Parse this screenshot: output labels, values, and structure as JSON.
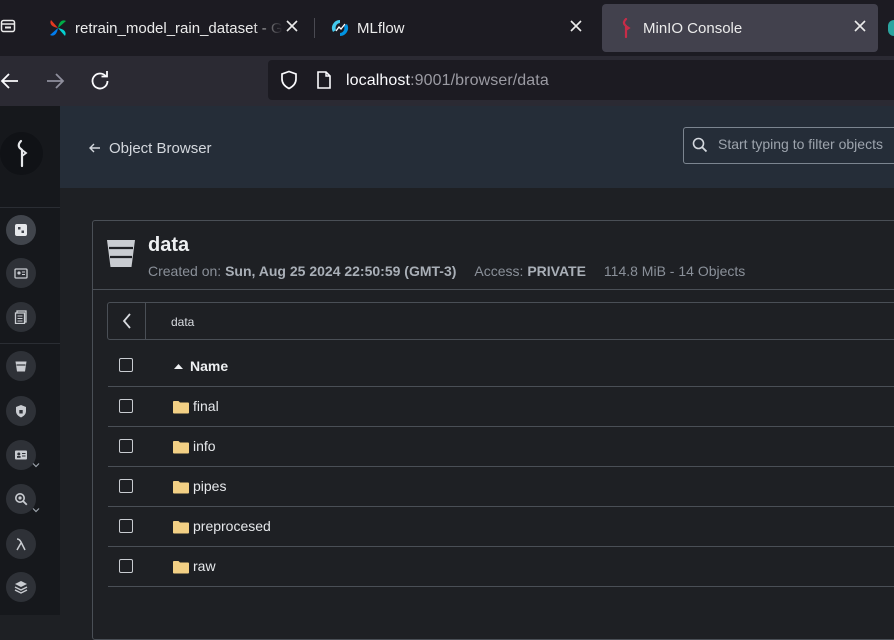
{
  "browser": {
    "tabs": [
      {
        "title": "retrain_model_rain_dataset - Gr",
        "favicon": "airflow-icon",
        "active": false
      },
      {
        "title": "MLflow",
        "favicon": "mlflow-icon",
        "active": false
      },
      {
        "title": "MinIO Console",
        "favicon": "minio-icon",
        "active": true
      }
    ],
    "url": {
      "host": "localhost",
      "rest": ":9001/browser/data"
    }
  },
  "sidebar": {
    "items": [
      "buckets-icon",
      "access-keys-icon",
      "documentation-icon",
      "bucket-icon",
      "policies-icon",
      "identity-icon",
      "monitoring-icon",
      "lambda-icon",
      "tiers-icon"
    ]
  },
  "header": {
    "back_label": "Object Browser",
    "filter_placeholder": "Start typing to filter objects"
  },
  "bucket": {
    "name": "data",
    "created_label": "Created on:",
    "created_value": "Sun, Aug 25 2024 22:50:59 (GMT-3)",
    "access_label": "Access:",
    "access_value": "PRIVATE",
    "size_summary": "114.8 MiB - 14 Objects"
  },
  "breadcrumb": {
    "path": "data"
  },
  "table": {
    "column_name": "Name",
    "rows": [
      {
        "name": "final",
        "type": "folder"
      },
      {
        "name": "info",
        "type": "folder"
      },
      {
        "name": "pipes",
        "type": "folder"
      },
      {
        "name": "preprocesed",
        "type": "folder"
      },
      {
        "name": "raw",
        "type": "folder"
      }
    ]
  },
  "colors": {
    "tab_strip": "#1c1b22",
    "toolbar": "#2b2a33",
    "sidebar": "#16181c",
    "header": "#252d38",
    "page": "#1e2024",
    "folder": "#f2d085"
  }
}
